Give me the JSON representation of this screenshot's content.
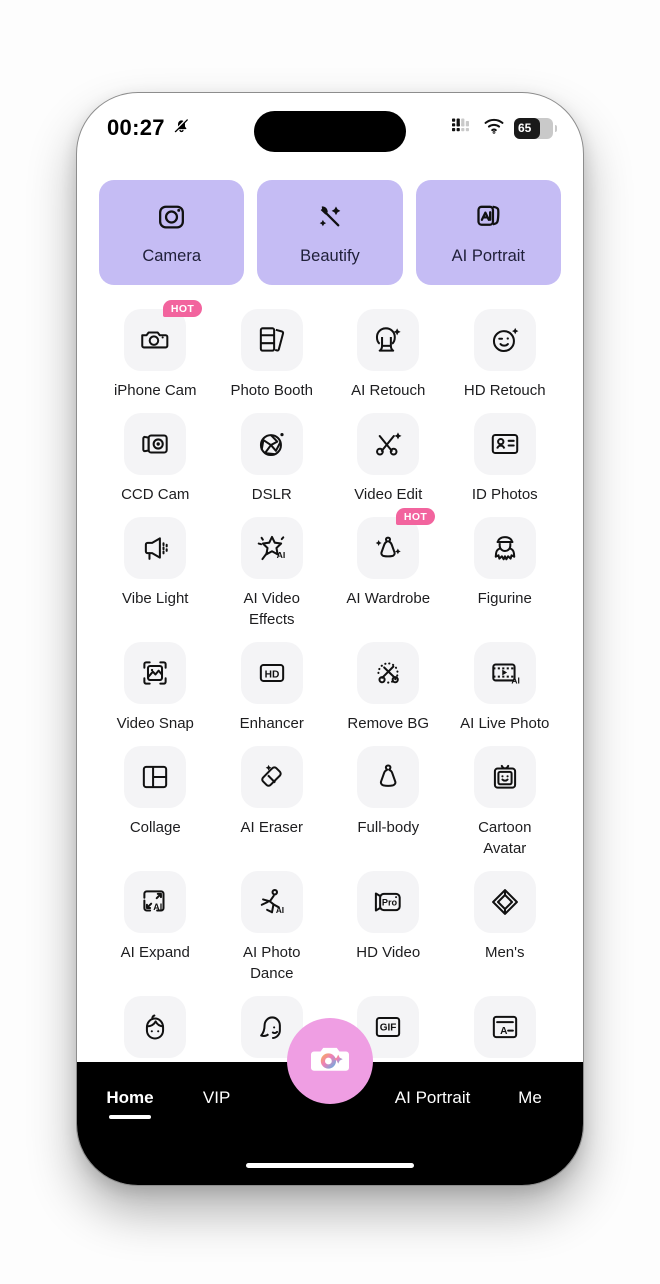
{
  "status_bar": {
    "time": "00:27",
    "bell_icon": "bell-muted-icon",
    "cellular_icon": "cellular-signal-icon",
    "wifi_icon": "wifi-icon",
    "battery_percent": "65"
  },
  "shortcuts": [
    {
      "label": "Camera",
      "icon": "camera-square-icon"
    },
    {
      "label": "Beautify",
      "icon": "magic-wand-icon"
    },
    {
      "label": "AI Portrait",
      "icon": "ai-photo-stack-icon"
    }
  ],
  "tools": [
    {
      "label": "iPhone Cam",
      "icon": "camera-icon",
      "badge": "HOT"
    },
    {
      "label": "Photo Booth",
      "icon": "photo-cards-icon",
      "badge": null
    },
    {
      "label": "AI Retouch",
      "icon": "portrait-sparkle-icon",
      "badge": null
    },
    {
      "label": "HD Retouch",
      "icon": "wink-face-icon",
      "badge": null
    },
    {
      "label": "CCD Cam",
      "icon": "ccd-camera-icon",
      "badge": null
    },
    {
      "label": "DSLR",
      "icon": "aperture-icon",
      "badge": null
    },
    {
      "label": "Video Edit",
      "icon": "scissors-sparkle-icon",
      "badge": null
    },
    {
      "label": "ID Photos",
      "icon": "id-card-icon",
      "badge": null
    },
    {
      "label": "Vibe Light",
      "icon": "studio-light-icon",
      "badge": null
    },
    {
      "label": "AI Video Effects",
      "icon": "star-ai-icon",
      "badge": null
    },
    {
      "label": "AI Wardrobe",
      "icon": "dress-sparkle-icon",
      "badge": "HOT"
    },
    {
      "label": "Figurine",
      "icon": "figurine-icon",
      "badge": null
    },
    {
      "label": "Video Snap",
      "icon": "photo-scan-icon",
      "badge": null
    },
    {
      "label": "Enhancer",
      "icon": "hd-box-icon",
      "badge": null
    },
    {
      "label": "Remove BG",
      "icon": "cutout-scissors-icon",
      "badge": null
    },
    {
      "label": "AI Live Photo",
      "icon": "film-play-ai-icon",
      "badge": null
    },
    {
      "label": "Collage",
      "icon": "collage-grid-icon",
      "badge": null
    },
    {
      "label": "AI Eraser",
      "icon": "eraser-sparkle-icon",
      "badge": null
    },
    {
      "label": "Full-body",
      "icon": "dress-icon",
      "badge": null
    },
    {
      "label": "Cartoon Avatar",
      "icon": "avatar-frame-icon",
      "badge": null
    },
    {
      "label": "AI Expand",
      "icon": "expand-ai-icon",
      "badge": null
    },
    {
      "label": "AI Photo Dance",
      "icon": "dancer-ai-icon",
      "badge": null
    },
    {
      "label": "HD Video",
      "icon": "video-pro-icon",
      "badge": null
    },
    {
      "label": "Men's",
      "icon": "diamond-icon",
      "badge": null
    }
  ],
  "tools_partial_row": [
    {
      "label": "",
      "icon": "boy-face-icon"
    },
    {
      "label": "",
      "icon": "girl-face-icon"
    },
    {
      "label": "",
      "icon": "gif-icon"
    },
    {
      "label": "",
      "icon": "text-doc-icon"
    }
  ],
  "tab_bar": {
    "items": [
      {
        "label": "Home",
        "active": true
      },
      {
        "label": "VIP",
        "active": false
      },
      {
        "label": "AI Portrait",
        "active": false
      },
      {
        "label": "Me",
        "active": false
      }
    ],
    "fab_icon": "camera-shutter-icon"
  },
  "colors": {
    "shortcut_card": "#c5bcf4",
    "tile_bg": "#f4f4f6",
    "hot_badge": "#f2649e",
    "fab": "#ef9ee3",
    "tab_bar": "#000000"
  }
}
